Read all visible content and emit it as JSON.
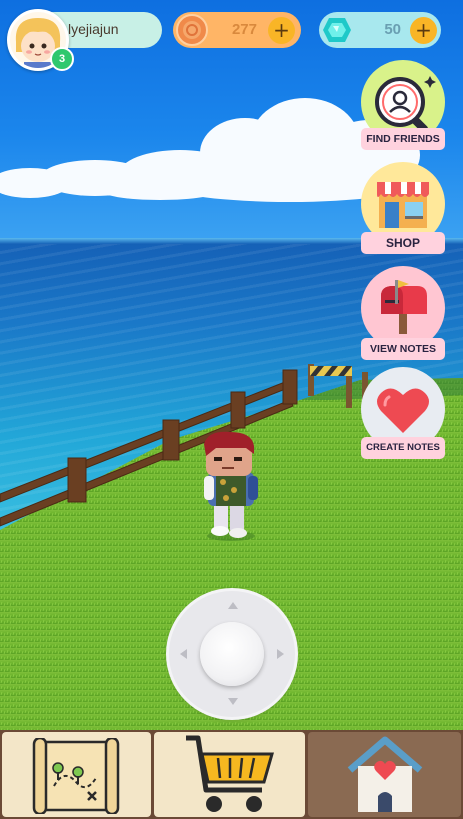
{
  "player": {
    "name": "lyejiajun",
    "level": "3"
  },
  "currency": {
    "coins": "277",
    "gems": "50"
  },
  "side_menu": {
    "find_friends": "FIND FRIENDS",
    "shop": "SHOP",
    "view_notes": "VIEW NOTES",
    "create_notes": "CREATE NOTES"
  },
  "icons": {
    "avatar": "avatar-girl-icon",
    "coin": "coin-icon",
    "gem": "diamond-icon",
    "plus": "plus-icon",
    "find_friends": "magnifier-user-icon",
    "shop": "storefront-icon",
    "view_notes": "mailbox-icon",
    "create_notes": "heart-icon",
    "map": "treasure-map-icon",
    "cart": "shopping-cart-icon",
    "home": "house-heart-icon"
  },
  "colors": {
    "player_pill": "#c8f0e6",
    "coin_pill": "#ffb566",
    "gem_pill": "#a8e8ee",
    "plus_button": "#f9b526",
    "side_label": "#ffd2de",
    "level_badge": "#2fc86e",
    "bottom_bar": "#6b4a36"
  }
}
